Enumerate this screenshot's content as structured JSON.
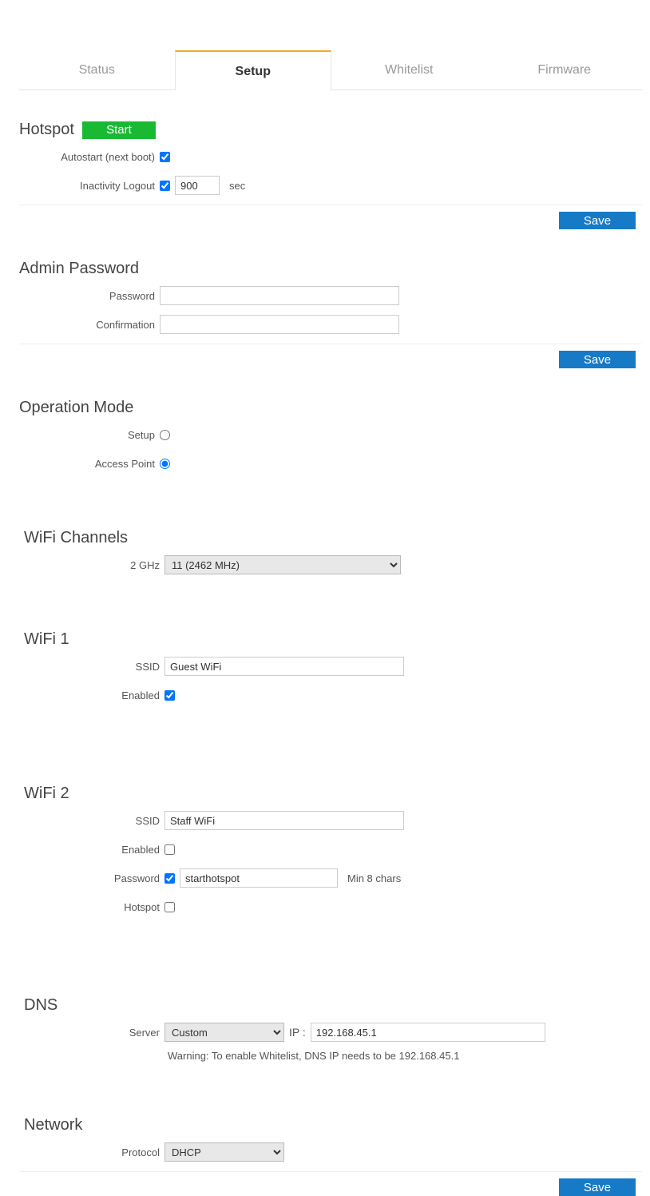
{
  "tabs": {
    "status": "Status",
    "setup": "Setup",
    "whitelist": "Whitelist",
    "firmware": "Firmware"
  },
  "hotspot": {
    "title": "Hotspot",
    "start": "Start",
    "autostart_label": "Autostart (next boot)",
    "autostart_checked": true,
    "inactivity_label": "Inactivity Logout",
    "inactivity_checked": true,
    "inactivity_value": "900",
    "inactivity_unit": "sec",
    "save": "Save"
  },
  "admin": {
    "title": "Admin Password",
    "password_label": "Password",
    "confirmation_label": "Confirmation",
    "save": "Save"
  },
  "opmode": {
    "title": "Operation Mode",
    "setup_label": "Setup",
    "ap_label": "Access Point",
    "selected": "ap"
  },
  "wifi_channels": {
    "title": "WiFi Channels",
    "ghz2_label": "2 GHz",
    "ghz2_value": "11 (2462 MHz)"
  },
  "wifi1": {
    "title": "WiFi 1",
    "ssid_label": "SSID",
    "ssid_value": "Guest WiFi",
    "enabled_label": "Enabled",
    "enabled_checked": true
  },
  "wifi2": {
    "title": "WiFi 2",
    "ssid_label": "SSID",
    "ssid_value": "Staff WiFi",
    "enabled_label": "Enabled",
    "enabled_checked": false,
    "password_label": "Password",
    "password_checked": true,
    "password_value": "starthotspot",
    "password_hint": "Min 8 chars",
    "hotspot_label": "Hotspot",
    "hotspot_checked": false
  },
  "dns": {
    "title": "DNS",
    "server_label": "Server",
    "server_value": "Custom",
    "ip_label": "IP :",
    "ip_value": "192.168.45.1",
    "warning": "Warning: To enable Whitelist, DNS IP needs to be 192.168.45.1"
  },
  "network": {
    "title": "Network",
    "protocol_label": "Protocol",
    "protocol_value": "DHCP",
    "save": "Save"
  }
}
